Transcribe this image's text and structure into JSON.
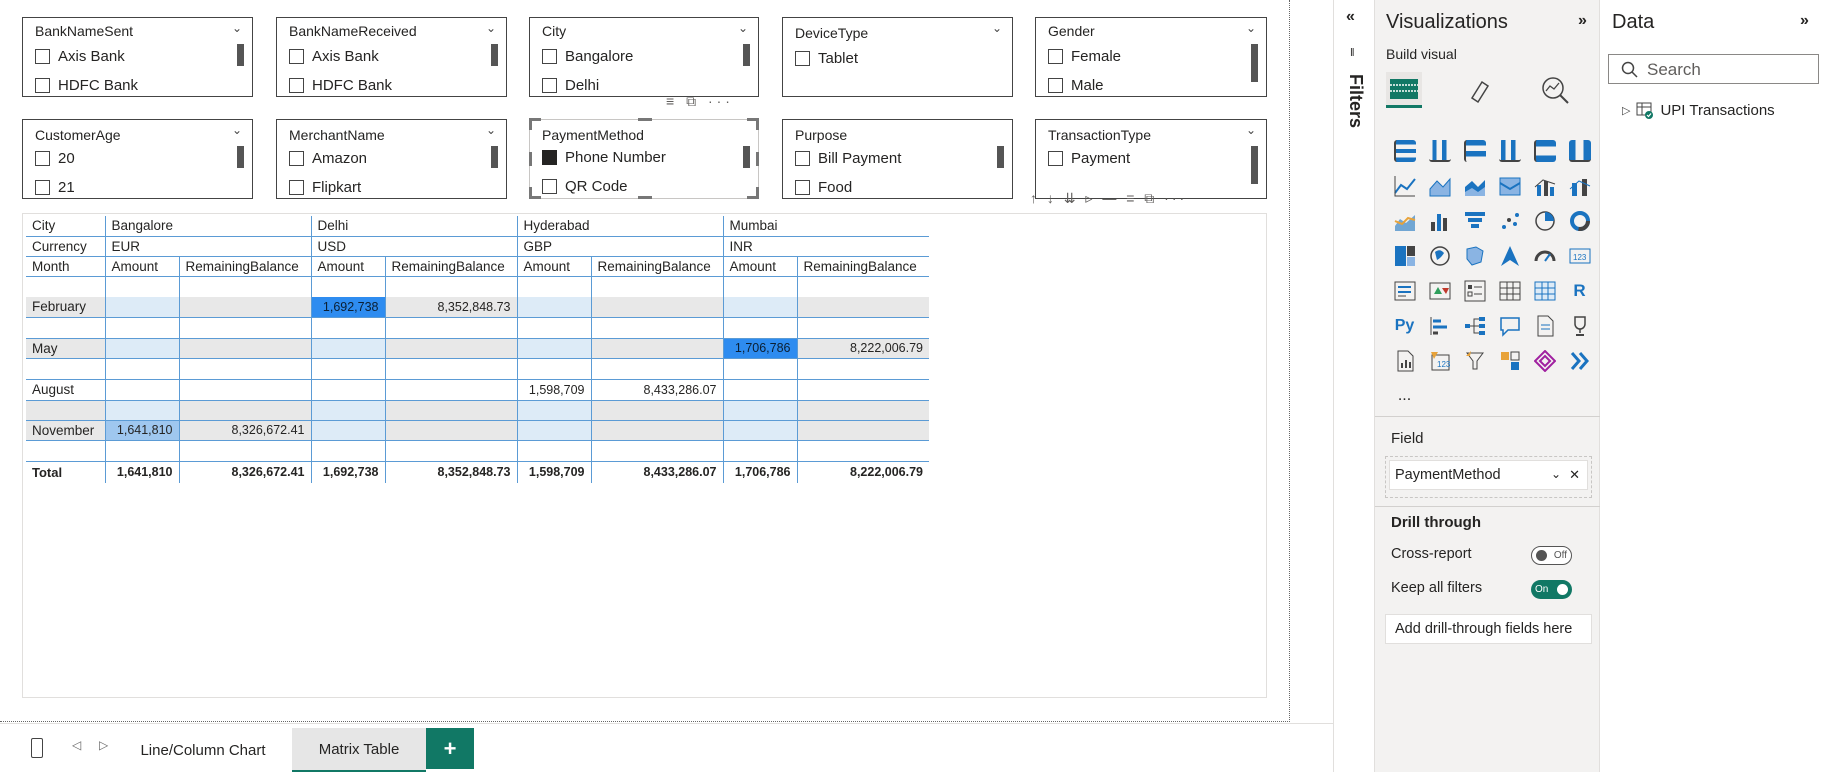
{
  "slicers": [
    {
      "title": "BankNameSent",
      "items": [
        "Axis Bank",
        "HDFC Bank"
      ]
    },
    {
      "title": "BankNameReceived",
      "items": [
        "Axis Bank",
        "HDFC Bank"
      ]
    },
    {
      "title": "City",
      "items": [
        "Bangalore",
        "Delhi"
      ]
    },
    {
      "title": "DeviceType",
      "items": [
        "Tablet"
      ]
    },
    {
      "title": "Gender",
      "items": [
        "Female",
        "Male"
      ]
    },
    {
      "title": "CustomerAge",
      "items": [
        "20",
        "21"
      ]
    },
    {
      "title": "MerchantName",
      "items": [
        "Amazon",
        "Flipkart"
      ]
    },
    {
      "title": "PaymentMethod",
      "items": [
        "Phone Number",
        "QR Code"
      ]
    },
    {
      "title": "Purpose",
      "items": [
        "Bill Payment",
        "Food"
      ]
    },
    {
      "title": "TransactionType",
      "items": [
        "Payment"
      ]
    }
  ],
  "matrix": {
    "row_headers": [
      "City",
      "Currency",
      "Month"
    ],
    "cities": [
      "Bangalore",
      "Delhi",
      "Hyderabad",
      "Mumbai"
    ],
    "currencies": [
      "EUR",
      "USD",
      "GBP",
      "INR"
    ],
    "measures": [
      "Amount",
      "RemainingBalance"
    ],
    "rows": [
      {
        "month": "February",
        "values": [
          "",
          "",
          "1,692,738",
          "8,352,848.73",
          "",
          "",
          "",
          ""
        ]
      },
      {
        "month": "May",
        "values": [
          "",
          "",
          "",
          "",
          "",
          "",
          "1,706,786",
          "8,222,006.79"
        ]
      },
      {
        "month": "August",
        "values": [
          "",
          "",
          "",
          "",
          "1,598,709",
          "8,433,286.07",
          "",
          ""
        ]
      },
      {
        "month": "November",
        "values": [
          "1,641,810",
          "8,326,672.41",
          "",
          "",
          "",
          "",
          "",
          ""
        ]
      }
    ],
    "total_label": "Total",
    "totals": [
      "1,641,810",
      "8,326,672.41",
      "1,692,738",
      "8,352,848.73",
      "1,598,709",
      "8,433,286.07",
      "1,706,786",
      "8,222,006.79"
    ]
  },
  "tabs": {
    "items": [
      "Line/Column Chart",
      "Matrix Table"
    ],
    "add": "+"
  },
  "filters_pane": {
    "label": "Filters"
  },
  "visualizations": {
    "title": "Visualizations",
    "build_visual": "Build visual",
    "more": "...",
    "field_label": "Field",
    "field_value": "PaymentMethod",
    "drill_through": "Drill through",
    "cross_report": "Cross-report",
    "cross_report_state": "Off",
    "keep_filters": "Keep all filters",
    "keep_filters_state": "On",
    "add_drill": "Add drill-through fields here",
    "r_icon": "R",
    "py_icon": "Py"
  },
  "data_pane": {
    "title": "Data",
    "search_placeholder": "Search",
    "table": "UPI Transactions"
  },
  "colors": {
    "accent": "#117865",
    "highlight": "#2e8cf0",
    "matrix_line": "#5b9bd5"
  }
}
